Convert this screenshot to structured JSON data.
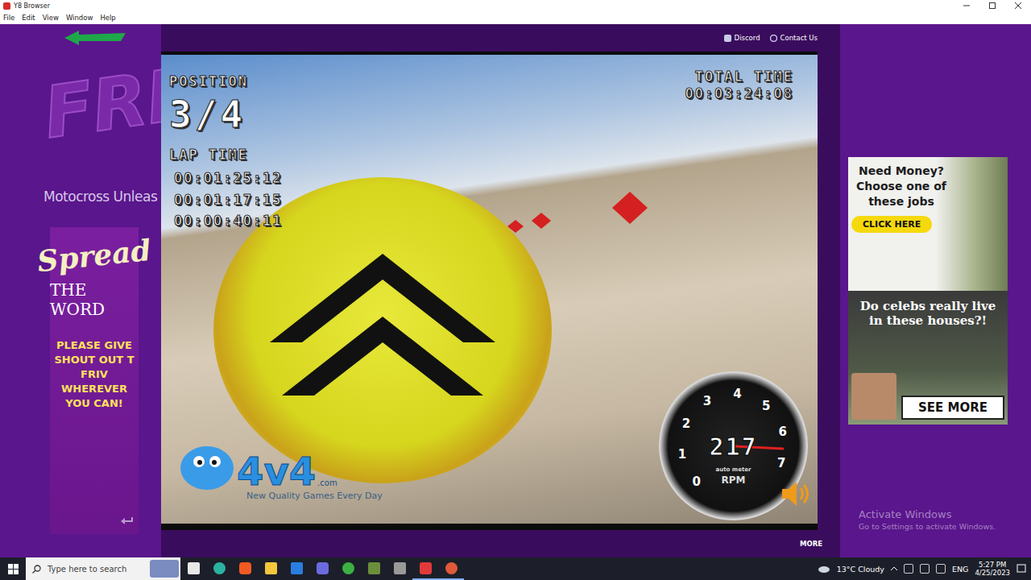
{
  "window": {
    "title": "Y8 Browser"
  },
  "menu": [
    "File",
    "Edit",
    "View",
    "Window",
    "Help"
  ],
  "sidebar": {
    "logo": "FRI",
    "game_title": "Motocross Unleas",
    "promo": {
      "title": "Spread",
      "subtitle": "THE WORD",
      "message": [
        "PLEASE GIVE",
        "SHOUT OUT T",
        "FRIV",
        "WHEREVER",
        "YOU CAN!"
      ]
    }
  },
  "top_links": [
    {
      "label": "Discord"
    },
    {
      "label": "Contact Us"
    }
  ],
  "game": {
    "position_label": "POSITION",
    "position": "3/4",
    "lap_label": "LAP TIME",
    "laps": [
      "00:01:25:12",
      "00:01:17:15",
      "00:00:40:11"
    ],
    "total_label": "TOTAL TIME",
    "total": "00:03:24:08",
    "speed": "217",
    "gauge_ticks": [
      "0",
      "1",
      "2",
      "3",
      "4",
      "5",
      "6",
      "7"
    ],
    "gauge_unit": "RPM",
    "gauge_brand": "auto meter",
    "rpm_level": 0.93,
    "sponsor": {
      "name": "4v4",
      "domain": ".com",
      "tagline": "New Quality Games Every Day"
    }
  },
  "more": "MORE",
  "ad": {
    "headline": "Need Money? Choose one of these jobs",
    "cta": "CLICK HERE",
    "headline2": "Do celebs really live in these houses?!",
    "cta2": "SEE MORE"
  },
  "watermark": {
    "title": "Activate Windows",
    "subtitle": "Go to Settings to activate Windows."
  },
  "taskbar": {
    "search_placeholder": "Type here to search",
    "weather": "13°C Cloudy",
    "language": "ENG",
    "time": "5:27 PM",
    "date": "4/25/2023"
  }
}
